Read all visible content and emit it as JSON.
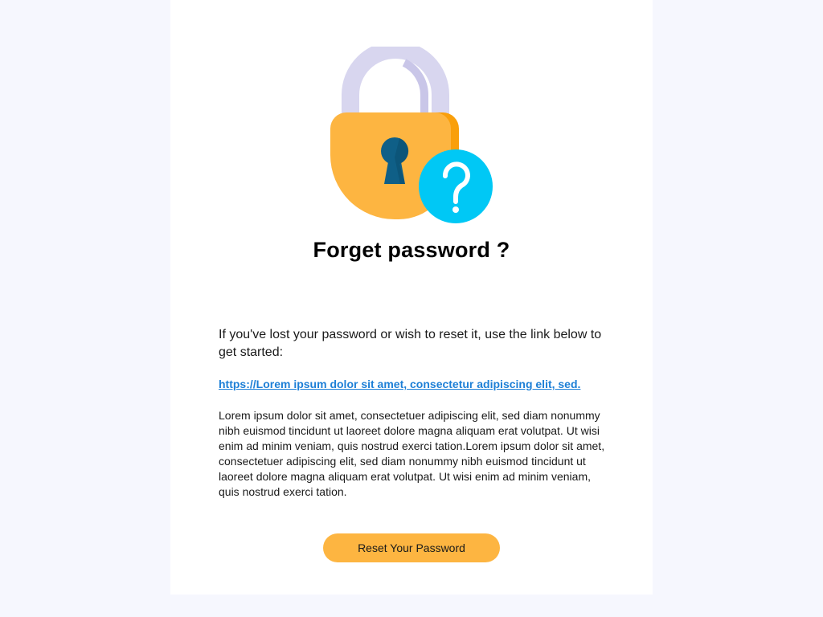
{
  "title": "Forget password ?",
  "intro_text": "If you've lost your password or wish to reset it, use the link below to get started:",
  "reset_link": "https://Lorem ipsum dolor sit amet, consectetur adipiscing elit, sed.",
  "body_text": "Lorem ipsum dolor sit amet, consectetuer adipiscing elit, sed diam nonummy nibh euismod tincidunt ut laoreet dolore magna aliquam erat volutpat. Ut wisi enim ad minim veniam, quis nostrud exerci tation.Lorem ipsum dolor sit amet, consectetuer adipiscing elit, sed diam nonummy nibh euismod tincidunt ut laoreet dolore magna aliquam erat volutpat. Ut wisi enim ad minim veniam, quis nostrud exerci tation.",
  "button_label": "Reset Your Password",
  "icons": {
    "main": "padlock-question-icon"
  },
  "colors": {
    "page_background": "#f6f7fe",
    "card_background": "#ffffff",
    "accent": "#fdb541",
    "link": "#1d7fd6",
    "lock_body": "#fdb541",
    "lock_shackle": "#d8d6ef",
    "keyhole": "#0f5f87",
    "question_badge": "#00c8f5"
  }
}
